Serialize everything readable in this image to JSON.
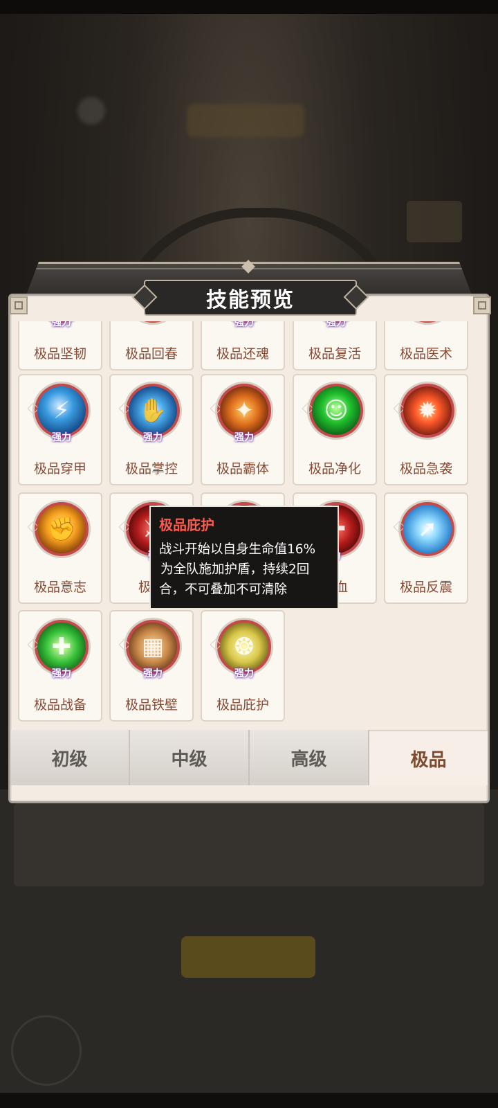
{
  "dialog": {
    "title": "技能预览"
  },
  "skills": [
    {
      "name": "极品坚韧",
      "badge": "强力",
      "theme": "blue"
    },
    {
      "name": "极品回春",
      "badge": "",
      "theme": "green"
    },
    {
      "name": "极品还魂",
      "badge": "强力",
      "theme": "fire"
    },
    {
      "name": "极品复活",
      "badge": "强力",
      "theme": "gold"
    },
    {
      "name": "极品医术",
      "badge": "",
      "theme": "lime"
    },
    {
      "name": "极品穿甲",
      "badge": "强力",
      "theme": "blue",
      "icon": "warrior-lightning-icon"
    },
    {
      "name": "极品掌控",
      "badge": "强力",
      "theme": "blue2",
      "icon": "grasping-hand-icon"
    },
    {
      "name": "极品霸体",
      "badge": "强力",
      "theme": "fire",
      "icon": "flaming-body-icon"
    },
    {
      "name": "极品净化",
      "badge": "",
      "theme": "green",
      "icon": "cleansed-figure-icon"
    },
    {
      "name": "极品急袭",
      "badge": "",
      "theme": "red",
      "icon": "burning-figure-icon"
    },
    {
      "name": "极品意志",
      "badge": "",
      "theme": "orange",
      "icon": "fist-icon"
    },
    {
      "name": "极品",
      "badge": "强",
      "theme": "darkred",
      "icon": "blade-slash-icon"
    },
    {
      "name": "",
      "badge": "",
      "theme": "dark",
      "icon": "shadow-icon"
    },
    {
      "name": "饮血",
      "badge": "力",
      "theme": "darkred",
      "icon": "blood-drop-icon"
    },
    {
      "name": "极品反震",
      "badge": "",
      "theme": "ice",
      "icon": "rebound-arrow-icon"
    },
    {
      "name": "极品战备",
      "badge": "强力",
      "theme": "lime",
      "icon": "healing-cross-icon"
    },
    {
      "name": "极品铁壁",
      "badge": "强力",
      "theme": "bronze",
      "icon": "iron-wall-icon"
    },
    {
      "name": "极品庇护",
      "badge": "强力",
      "theme": "gold",
      "icon": "shield-aura-icon"
    }
  ],
  "tooltip": {
    "title": "极品庇护",
    "line1": "战斗开始以自身生命值16%",
    "line2": "为全队施加护盾，持续2回",
    "line3": "合，不可叠加不可清除"
  },
  "tabs": [
    {
      "label": "初级",
      "active": false
    },
    {
      "label": "中级",
      "active": false
    },
    {
      "label": "高级",
      "active": false
    },
    {
      "label": "极品",
      "active": true
    }
  ]
}
